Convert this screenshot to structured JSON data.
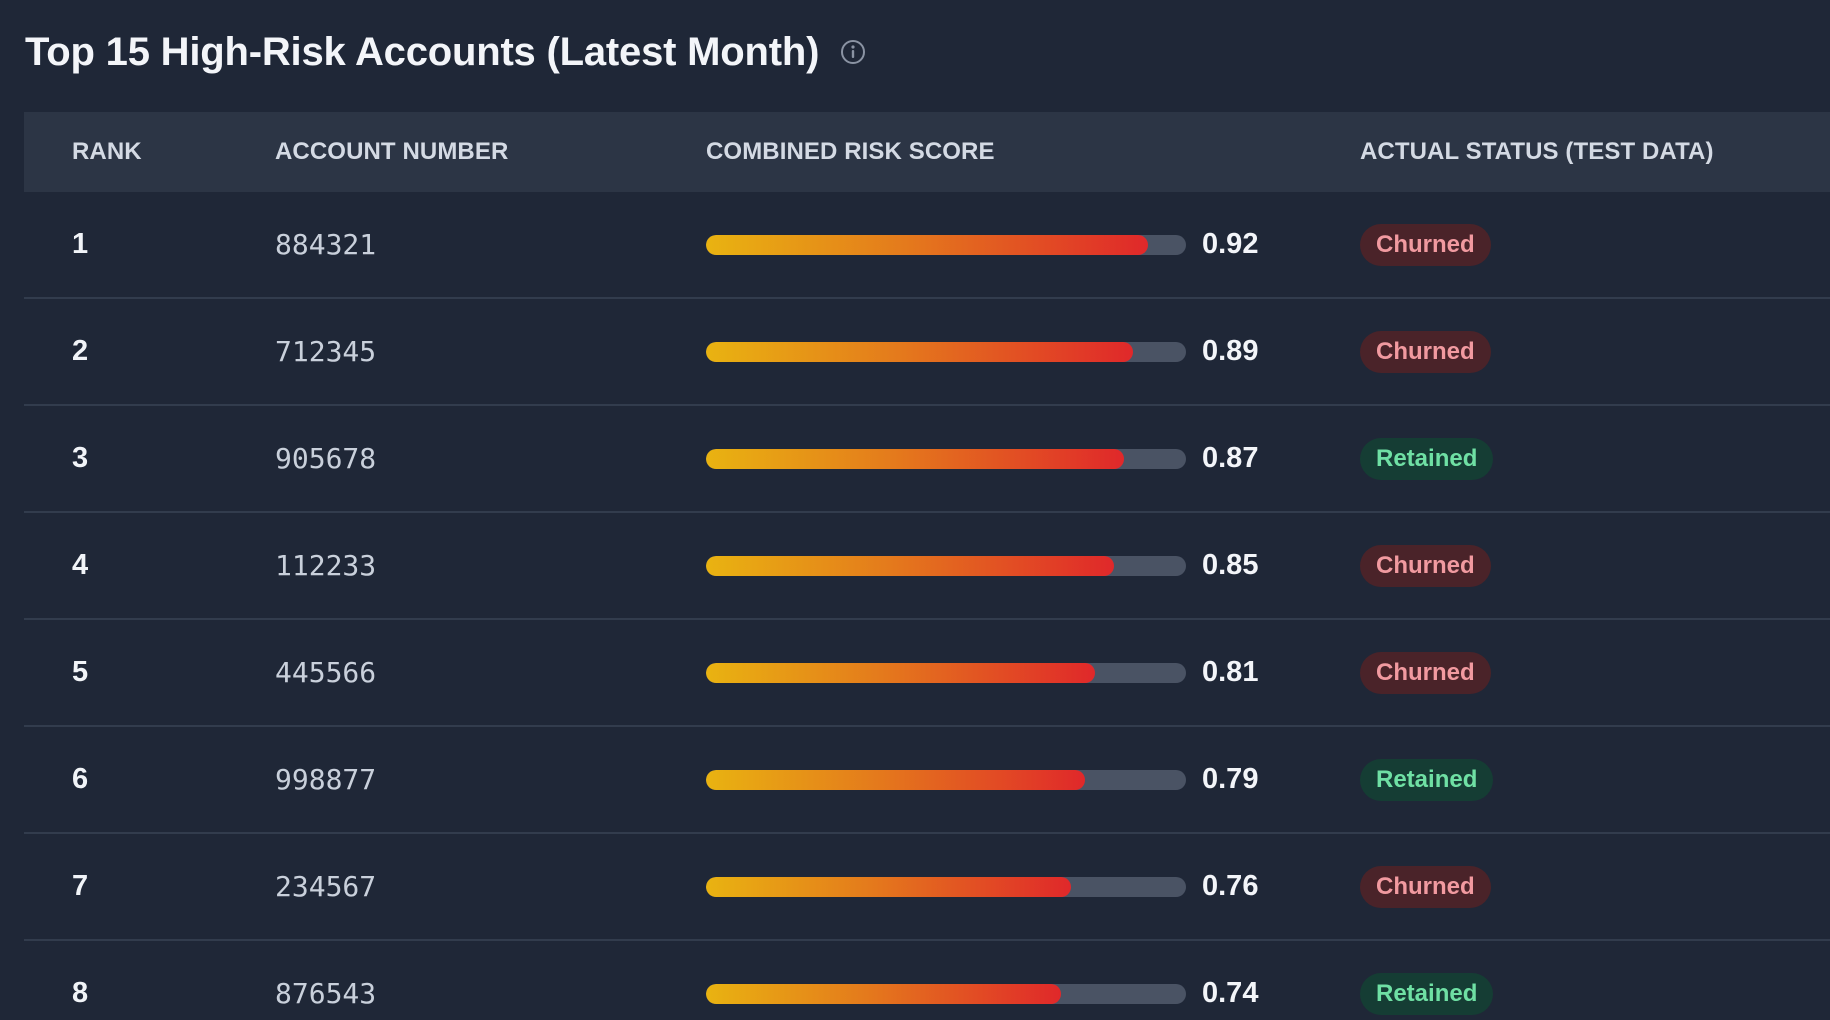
{
  "title": "Top 15 High-Risk Accounts (Latest Month)",
  "icons": {
    "info": "info-circle-icon"
  },
  "columns": {
    "rank": "RANK",
    "account": "ACCOUNT NUMBER",
    "score": "COMBINED RISK SCORE",
    "status": "ACTUAL STATUS (TEST DATA)"
  },
  "colors": {
    "background": "#1f2737",
    "header_bg": "#2c3545",
    "bar_start": "#e9b311",
    "bar_end": "#e0282a",
    "churned_text": "#f19aa0",
    "retained_text": "#6fe0a4"
  },
  "rows": [
    {
      "rank": "1",
      "account": "884321",
      "score": 0.92,
      "score_label": "0.92",
      "status": "Churned"
    },
    {
      "rank": "2",
      "account": "712345",
      "score": 0.89,
      "score_label": "0.89",
      "status": "Churned"
    },
    {
      "rank": "3",
      "account": "905678",
      "score": 0.87,
      "score_label": "0.87",
      "status": "Retained"
    },
    {
      "rank": "4",
      "account": "112233",
      "score": 0.85,
      "score_label": "0.85",
      "status": "Churned"
    },
    {
      "rank": "5",
      "account": "445566",
      "score": 0.81,
      "score_label": "0.81",
      "status": "Churned"
    },
    {
      "rank": "6",
      "account": "998877",
      "score": 0.79,
      "score_label": "0.79",
      "status": "Retained"
    },
    {
      "rank": "7",
      "account": "234567",
      "score": 0.76,
      "score_label": "0.76",
      "status": "Churned"
    },
    {
      "rank": "8",
      "account": "876543",
      "score": 0.74,
      "score_label": "0.74",
      "status": "Retained"
    }
  ]
}
